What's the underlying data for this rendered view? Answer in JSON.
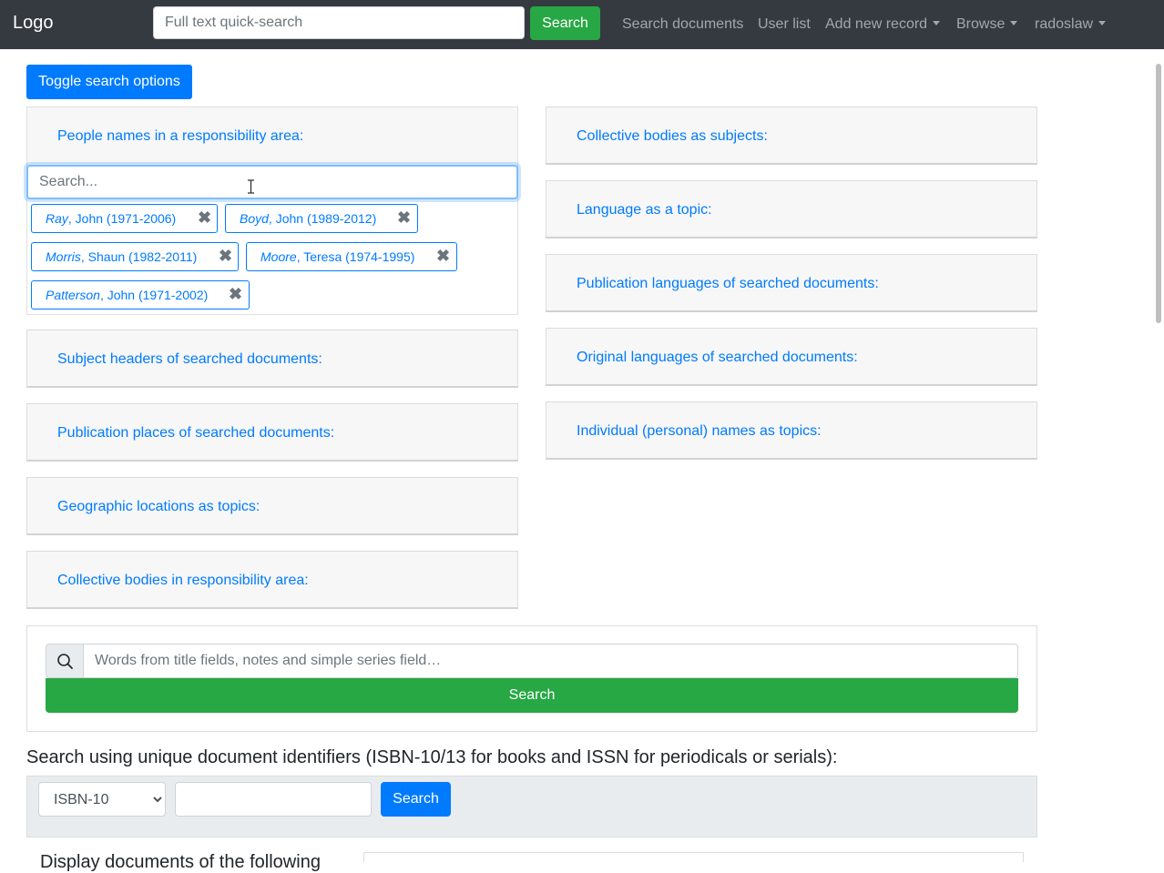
{
  "navbar": {
    "brand": "Logo",
    "quicksearch_placeholder": "Full text quick-search",
    "quicksearch_button": "Search",
    "items": [
      {
        "label": "Search documents"
      },
      {
        "label": "User list"
      },
      {
        "label": "Add new record"
      },
      {
        "label": "Browse"
      },
      {
        "label": "radoslaw"
      }
    ]
  },
  "toggle_button": "Toggle search options",
  "people_card": {
    "title": "People names in a responsibility area:",
    "search_placeholder": "Search...",
    "tags": [
      {
        "surname": "Ray",
        "rest": ", John (1971-2006)"
      },
      {
        "surname": "Boyd",
        "rest": ", John (1989-2012)"
      },
      {
        "surname": "Morris",
        "rest": ", Shaun (1982-2011)"
      },
      {
        "surname": "Moore",
        "rest": ", Teresa (1974-1995)"
      },
      {
        "surname": "Patterson",
        "rest": ", John (1971-2002)"
      }
    ]
  },
  "left_cards": [
    {
      "title": "Subject headers of searched documents:"
    },
    {
      "title": "Publication places of searched documents:"
    },
    {
      "title": "Geographic locations as topics:"
    },
    {
      "title": "Collective bodies in responsibility area:"
    }
  ],
  "right_cards": [
    {
      "title": "Collective bodies as subjects:"
    },
    {
      "title": "Language as a topic:"
    },
    {
      "title": "Publication languages of searched documents:"
    },
    {
      "title": "Original languages of searched documents:"
    },
    {
      "title": "Individual (personal) names as topics:"
    }
  ],
  "main_search": {
    "placeholder": "Words from title fields, notes and simple series field…",
    "button": "Search"
  },
  "identifier_search": {
    "label": "Search using unique document identifiers (ISBN-10/13 for books and ISSN for periodicals or serials):",
    "selected": "ISBN-10",
    "button": "Search"
  },
  "cut_off_text": "Display documents of the following"
}
